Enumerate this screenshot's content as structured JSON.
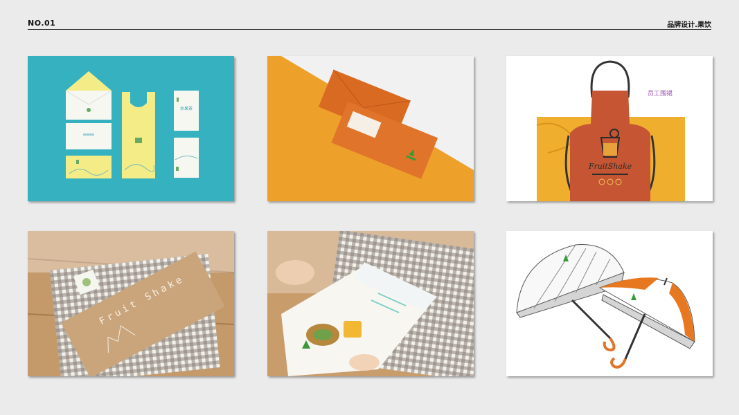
{
  "header": {
    "number": "NO.01",
    "title": "品牌设计.果饮"
  },
  "tiles": {
    "stationery": {
      "business_card_name": "水果茶"
    },
    "apron": {
      "caption": "员工围裙",
      "brand_script": "FruitShake"
    },
    "paper_bag": {
      "brand_text": "Fruit Shake"
    }
  },
  "colors": {
    "teal": "#35b1c0",
    "yellow": "#f4ec86",
    "orange": "#eda12b",
    "brand_orange": "#e0742a",
    "apron_red": "#c55533",
    "purple": "#9b59b6",
    "brand_green": "#3a9a3a"
  }
}
